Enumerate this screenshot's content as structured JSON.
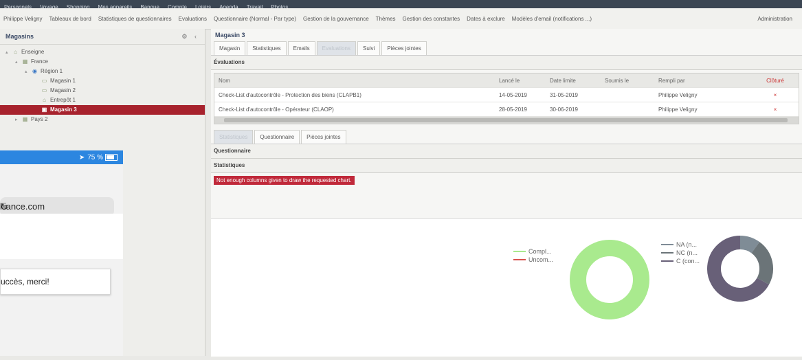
{
  "bookmarks": [
    "Personnels",
    "Voyage",
    "Shopping",
    "Mes appareils",
    "Banque",
    "Compte",
    "Loisirs",
    "Agenda",
    "Travail",
    "Photos"
  ],
  "menu": {
    "user": "Philippe Veligny",
    "items": [
      "Tableaux de bord",
      "Statistiques de questionnaires",
      "Evaluations",
      "Questionnaire (Normal - Par type)",
      "Gestion de la gouvernance",
      "Thèmes",
      "Gestion des constantes",
      "Dates à exclure",
      "Modèles d'email (notifications ...)"
    ],
    "admin": "Administration"
  },
  "left": {
    "title": "Magasins",
    "tree": [
      {
        "label": "Enseigne",
        "icon": "home-icon",
        "depth": 0,
        "toggle": "▴"
      },
      {
        "label": "France",
        "icon": "flag-icon",
        "depth": 1,
        "toggle": "▴"
      },
      {
        "label": "Région 1",
        "icon": "globe-icon",
        "depth": 2,
        "toggle": "▴"
      },
      {
        "label": "Magasin 1",
        "icon": "store-icon",
        "depth": 3,
        "toggle": ""
      },
      {
        "label": "Magasin 2",
        "icon": "store-icon",
        "depth": 3,
        "toggle": ""
      },
      {
        "label": "Entrepôt 1",
        "icon": "home-icon",
        "depth": 3,
        "toggle": ""
      },
      {
        "label": "Magasin 3",
        "icon": "cart-icon",
        "depth": 3,
        "toggle": "",
        "selected": true
      },
      {
        "label": "Pays 2",
        "icon": "flag-icon",
        "depth": 1,
        "toggle": "▸"
      }
    ]
  },
  "main": {
    "title": "Magasin 3",
    "tabs": [
      "Magasin",
      "Statistiques",
      "Emails",
      "Evaluations",
      "Suivi",
      "Pièces jointes"
    ],
    "active_tab": 3,
    "evaluations_title": "Évaluations",
    "columns": [
      "Nom",
      "Lancé le",
      "Date limite",
      "Soumis le",
      "Rempli par",
      "Clôturé"
    ],
    "rows": [
      [
        "Check-List d'autocontrôle - Protection des biens (CLAPB1)",
        "14-05-2019",
        "31-05-2019",
        "",
        "Philippe Veligny",
        "×"
      ],
      [
        "Check-List d'autocontrôle - Opérateur (CLAOP)",
        "28-05-2019",
        "30-06-2019",
        "",
        "Philippe Veligny",
        "×"
      ]
    ],
    "subtabs": [
      "Statistiques",
      "Questionnaire",
      "Pièces jointes"
    ],
    "active_subtab": 0,
    "questionnaire_label": "Questionnaire",
    "statistiques_label": "Statistiques",
    "error": "Not enough columns given to draw the requested chart."
  },
  "chart_data": [
    {
      "type": "pie",
      "series": [
        {
          "name": "Compl...",
          "values": [
            100
          ],
          "color": "#a9ea8e"
        },
        {
          "name": "Uncom...",
          "values": [
            0
          ],
          "color": "#d9534f"
        }
      ]
    },
    {
      "type": "pie",
      "series": [
        {
          "name": "NA (n...",
          "values": [
            10
          ],
          "color": "#7f8c96"
        },
        {
          "name": "NC (n...",
          "values": [
            23
          ],
          "color": "#6b7478"
        },
        {
          "name": "C (con...",
          "values": [
            67
          ],
          "color": "#686078"
        }
      ]
    }
  ],
  "phone": {
    "signal": "75 %",
    "url": "lliance.com",
    "toast": "uccès, merci!"
  }
}
